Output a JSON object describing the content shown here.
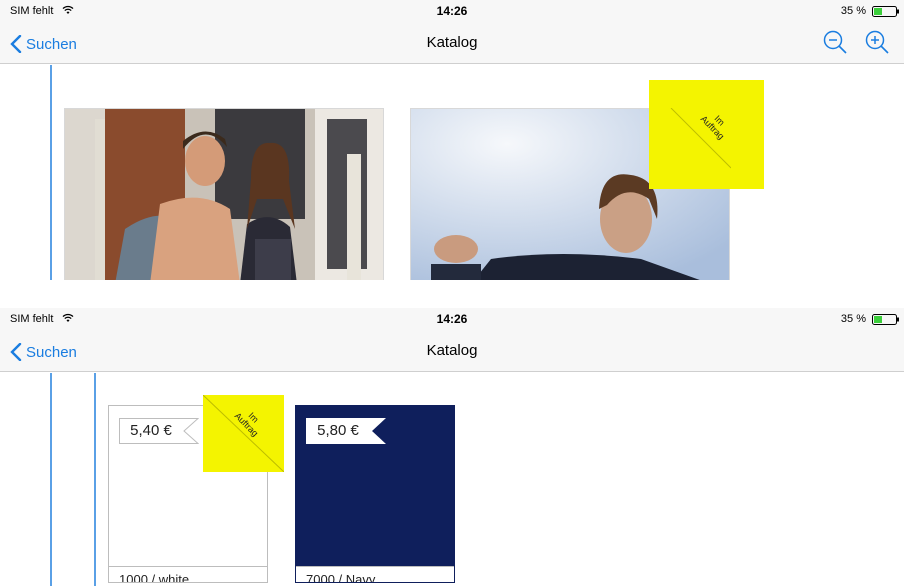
{
  "screens": [
    {
      "status": {
        "carrier": "SIM fehlt",
        "time": "14:26",
        "battery": "35 %"
      },
      "nav": {
        "back_label": "Suchen",
        "title": "Katalog",
        "zoom_out": "zoom-out-icon",
        "zoom_in": "zoom-in-icon"
      },
      "marker": {
        "line1": "Im",
        "line2": "Auftrag"
      }
    },
    {
      "status": {
        "carrier": "SIM fehlt",
        "time": "14:26",
        "battery": "35 %"
      },
      "nav": {
        "back_label": "Suchen",
        "title": "Katalog"
      },
      "products": [
        {
          "price": "5,40 €",
          "variant": "1000 / white",
          "color": "#ffffff"
        },
        {
          "price": "5,80 €",
          "variant": "7000 / Navy",
          "color": "#0f1f5c"
        }
      ],
      "marker": {
        "line1": "Im",
        "line2": "Auftrag"
      }
    }
  ],
  "colors": {
    "accent": "#1a7de0",
    "marker": "#f4f400",
    "navy": "#0f1f5c"
  }
}
